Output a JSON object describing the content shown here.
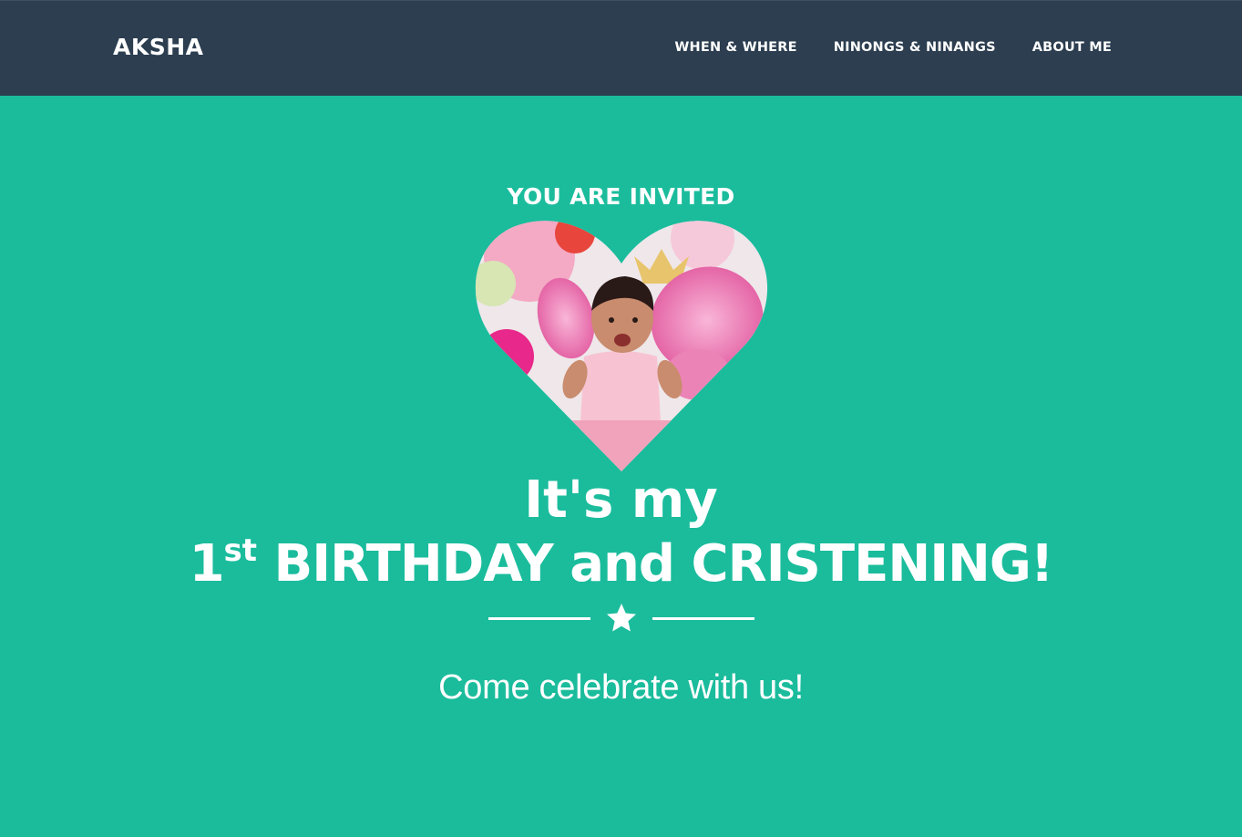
{
  "nav": {
    "brand": "AKSHA",
    "links": [
      "WHEN & WHERE",
      "NINONGS & NINANGS",
      "ABOUT ME"
    ]
  },
  "hero": {
    "eyebrow": "YOU ARE INVITED",
    "photo_icon": "heart-photo",
    "heading_line1": "It's my",
    "heading_number": "1",
    "heading_ordinal": "st",
    "heading_line2": " BIRTHDAY and CRISTENING!",
    "divider_icon": "star-icon",
    "tagline": "Come celebrate with us!"
  },
  "colors": {
    "navbar": "#2c3e50",
    "background": "#1abc9c",
    "text": "#ffffff"
  }
}
